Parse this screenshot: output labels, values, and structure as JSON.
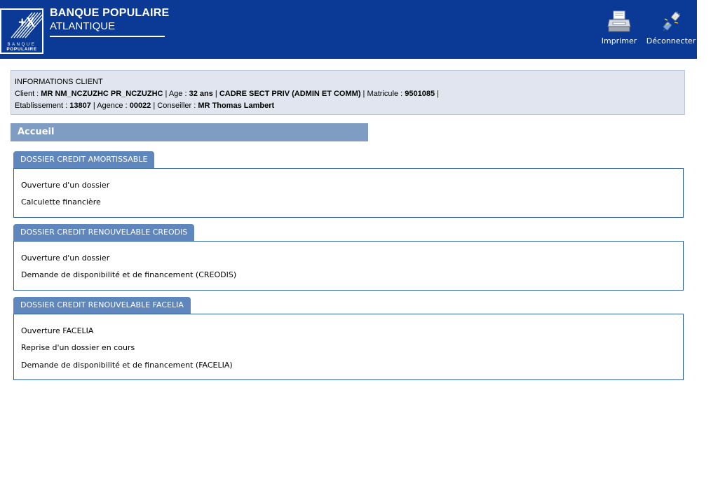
{
  "header": {
    "brand_line1": "BANQUE POPULAIRE",
    "brand_line2": "ATLANTIQUE",
    "logo_text_top": "BANQUE",
    "logo_text_bottom": "POPULAIRE",
    "logo_mark": "+X",
    "bg_color": "#0b3a96",
    "tools": {
      "print_label": "Imprimer",
      "print_icon": "printer-icon",
      "logout_label": "Déconnecter",
      "logout_icon": "plug-disconnect-icon"
    }
  },
  "client": {
    "title": "INFORMATIONS CLIENT",
    "client_label": "Client : ",
    "client_name": "MR NM_NCZUZHC PR_NCZUZHC",
    "age_label": " | Age : ",
    "age_value": "32 ans",
    "sep1": " | ",
    "category": "CADRE SECT PRIV (ADMIN ET COMM)",
    "matricule_label": " | Matricule : ",
    "matricule_value": "9501085",
    "end_sep": " |",
    "etab_label": "Etablissement : ",
    "etab_value": "13807",
    "agence_label": " | Agence : ",
    "agence_value": "00022",
    "conseiller_label": " | Conseiller : ",
    "conseiller_value": "MR Thomas Lambert"
  },
  "page": {
    "title": "Accueil"
  },
  "sections": [
    {
      "title": "DOSSIER CREDIT AMORTISSABLE",
      "links": [
        "Ouverture d'un dossier",
        "Calculette financière"
      ]
    },
    {
      "title": "DOSSIER CREDIT RENOUVELABLE CREODIS",
      "links": [
        "Ouverture d'un dossier",
        "Demande de disponibilité et de financement (CREODIS)"
      ]
    },
    {
      "title": "DOSSIER CREDIT RENOUVELABLE FACELIA",
      "links": [
        "Ouverture FACELIA",
        "Reprise d'un dossier en cours",
        "Demande de disponibilité et de financement (FACELIA)"
      ]
    }
  ]
}
